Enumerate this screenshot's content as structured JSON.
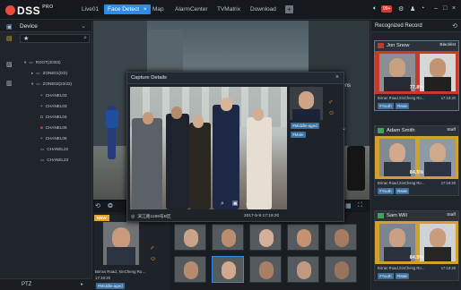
{
  "app": {
    "name": "DSS",
    "edition": "PRO"
  },
  "nav": {
    "tabs": [
      {
        "label": "Live01"
      },
      {
        "label": "Face Detect",
        "close": "×"
      },
      {
        "label": "Map"
      },
      {
        "label": "AlarmCenter"
      },
      {
        "label": "TVMatrix"
      },
      {
        "label": "Download"
      }
    ],
    "add_tab": "+",
    "alarm_count": "99+",
    "window_controls": {
      "minimize": "–",
      "maximize": "□",
      "close": "×"
    }
  },
  "left_panel": {
    "title": "Device",
    "tree": [
      {
        "label": "ROOT(3/303)",
        "level": 0
      },
      {
        "label": "ZONE01(0/2)",
        "level": 1
      },
      {
        "label": "ZONE02(22/22)",
        "level": 1
      },
      {
        "label": "CHANEL02",
        "level": 2
      },
      {
        "label": "CHANEL03",
        "level": 2
      },
      {
        "label": "CHANEL04",
        "level": 2
      },
      {
        "label": "CHANEL05",
        "level": 2
      },
      {
        "label": "CHANEL06",
        "level": 2
      },
      {
        "label": "CHANEL22",
        "level": 2
      },
      {
        "label": "CHANEL23",
        "level": 2
      }
    ],
    "ptz_label": "PTZ"
  },
  "video": {
    "overlay_text": "ions"
  },
  "capture_popup": {
    "title": "Capture  Details",
    "location": "滨江路1199号B区",
    "time": "2017-5-9 17:19:20",
    "tags": [
      "#Middle-aged",
      "#Male"
    ]
  },
  "capture_feed": {
    "new_badge": "NEW",
    "address": "Bin'an Road, XinCheng Ro...",
    "time": "17:19:20",
    "tag": "#Middle-aged"
  },
  "recognized": {
    "title": "Recognized Record",
    "records": [
      {
        "name": "Jon Snow",
        "list": "Blacklist",
        "similarity": "77.8%",
        "address": "Bin'an Road,XinCheng Ro...",
        "time": "17:19:20",
        "tags": [
          "#Youth",
          "#Male"
        ],
        "status_color": "#c0392b"
      },
      {
        "name": "Adam Smith",
        "list": "Staff",
        "similarity": "84.5%",
        "address": "Bin'an Road,XinCheng Ro...",
        "time": "17:19:20",
        "tags": [
          "#Youth",
          "#Male"
        ],
        "status_color": "#3fa45a"
      },
      {
        "name": "Sam Will",
        "list": "Staff",
        "similarity": "84.5%",
        "address": "Bin'an Road,XinCheng Ro...",
        "time": "17:19:20",
        "tags": [
          "#Youth",
          "#Male"
        ],
        "status_color": "#3fa45a"
      }
    ]
  },
  "colors": {
    "accent": "#2e8be6",
    "alert": "#e2453b",
    "tag": "#3a6f9f",
    "highlight": "#f2b531"
  }
}
